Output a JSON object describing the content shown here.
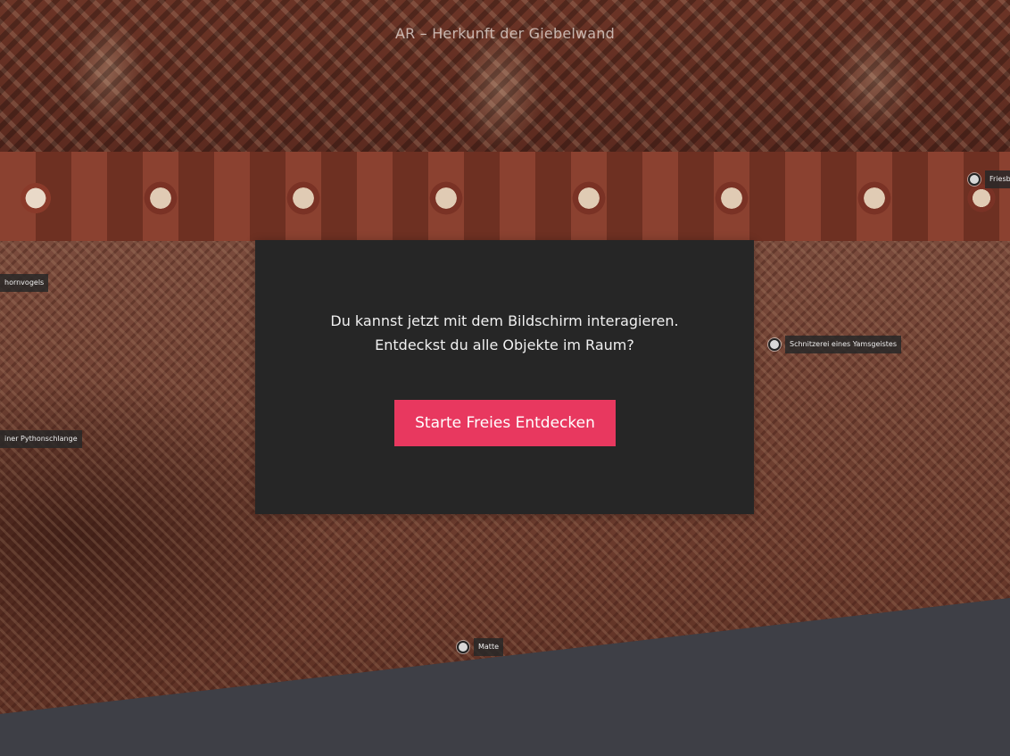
{
  "header": {
    "title": "AR – Herkunft der Giebelwand"
  },
  "hotspots": [
    {
      "id": "friesbalken",
      "label": "Friesb"
    },
    {
      "id": "nashornvogel",
      "label": "hornvogels"
    },
    {
      "id": "yamsgeist",
      "label": "Schnitzerei eines Yamsgeistes"
    },
    {
      "id": "pythonschlange",
      "label": "iner Pythonschlange"
    },
    {
      "id": "matte",
      "label": "Matte"
    }
  ],
  "modal": {
    "line1": "Du kannst jetzt mit dem Bildschirm interagieren.",
    "line2": "Entdeckst du alle Objekte im Raum?",
    "button_label": "Starte Freies Entdecken"
  },
  "colors": {
    "accent": "#e8385f",
    "modal_bg": "#262626",
    "bottom_bar": "#3e3f46"
  }
}
